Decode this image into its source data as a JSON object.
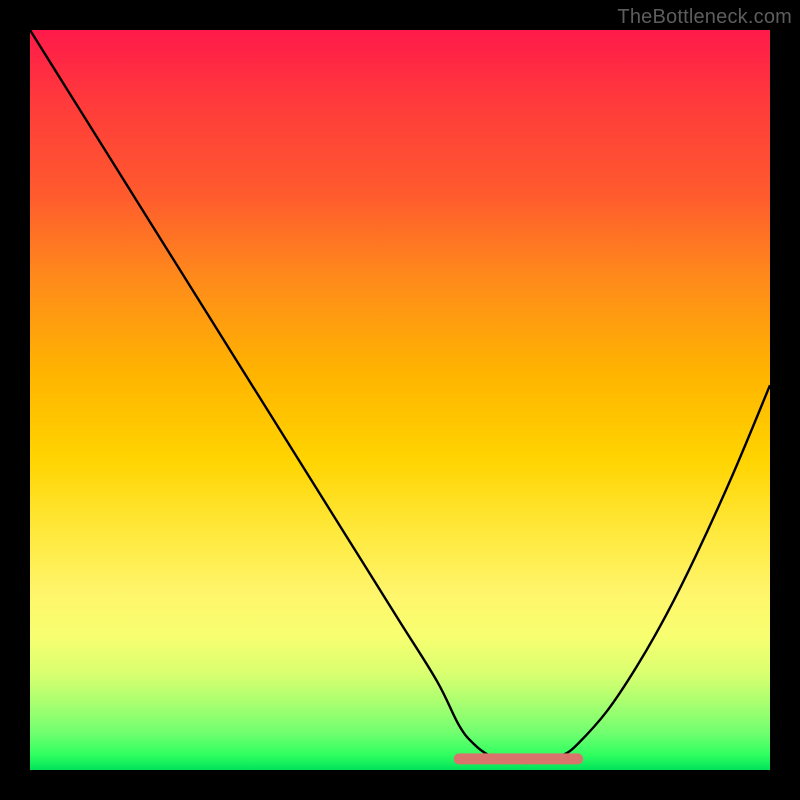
{
  "watermark": "TheBottleneck.com",
  "chart_data": {
    "type": "line",
    "title": "",
    "xlabel": "",
    "ylabel": "",
    "xlim": [
      0,
      100
    ],
    "ylim": [
      0,
      100
    ],
    "series": [
      {
        "name": "curve",
        "x": [
          0,
          5,
          10,
          15,
          20,
          25,
          30,
          35,
          40,
          45,
          50,
          55,
          58,
          60,
          62,
          64,
          66,
          68,
          70,
          72,
          74,
          78,
          82,
          86,
          90,
          95,
          100
        ],
        "values": [
          100,
          92,
          84,
          76,
          68,
          60,
          52,
          44,
          36,
          28,
          20,
          12,
          6,
          3.5,
          2,
          1.3,
          1,
          1,
          1.3,
          2,
          3.5,
          8,
          14,
          21,
          29,
          40,
          52
        ]
      }
    ],
    "highlight": {
      "name": "bottom-band",
      "x_start": 58,
      "x_end": 74,
      "y": 1.5,
      "color": "#d9746c"
    },
    "background_gradient": {
      "stops": [
        {
          "pos": 0.0,
          "color": "#ff1a4a"
        },
        {
          "pos": 0.1,
          "color": "#ff3b3b"
        },
        {
          "pos": 0.22,
          "color": "#ff5a2e"
        },
        {
          "pos": 0.34,
          "color": "#ff8c1a"
        },
        {
          "pos": 0.46,
          "color": "#ffb300"
        },
        {
          "pos": 0.58,
          "color": "#ffd400"
        },
        {
          "pos": 0.68,
          "color": "#ffe93d"
        },
        {
          "pos": 0.76,
          "color": "#fff56b"
        },
        {
          "pos": 0.82,
          "color": "#f7ff70"
        },
        {
          "pos": 0.87,
          "color": "#d9ff70"
        },
        {
          "pos": 0.91,
          "color": "#a8ff70"
        },
        {
          "pos": 0.95,
          "color": "#70ff70"
        },
        {
          "pos": 0.98,
          "color": "#2eff60"
        },
        {
          "pos": 1.0,
          "color": "#00e25a"
        }
      ]
    }
  }
}
